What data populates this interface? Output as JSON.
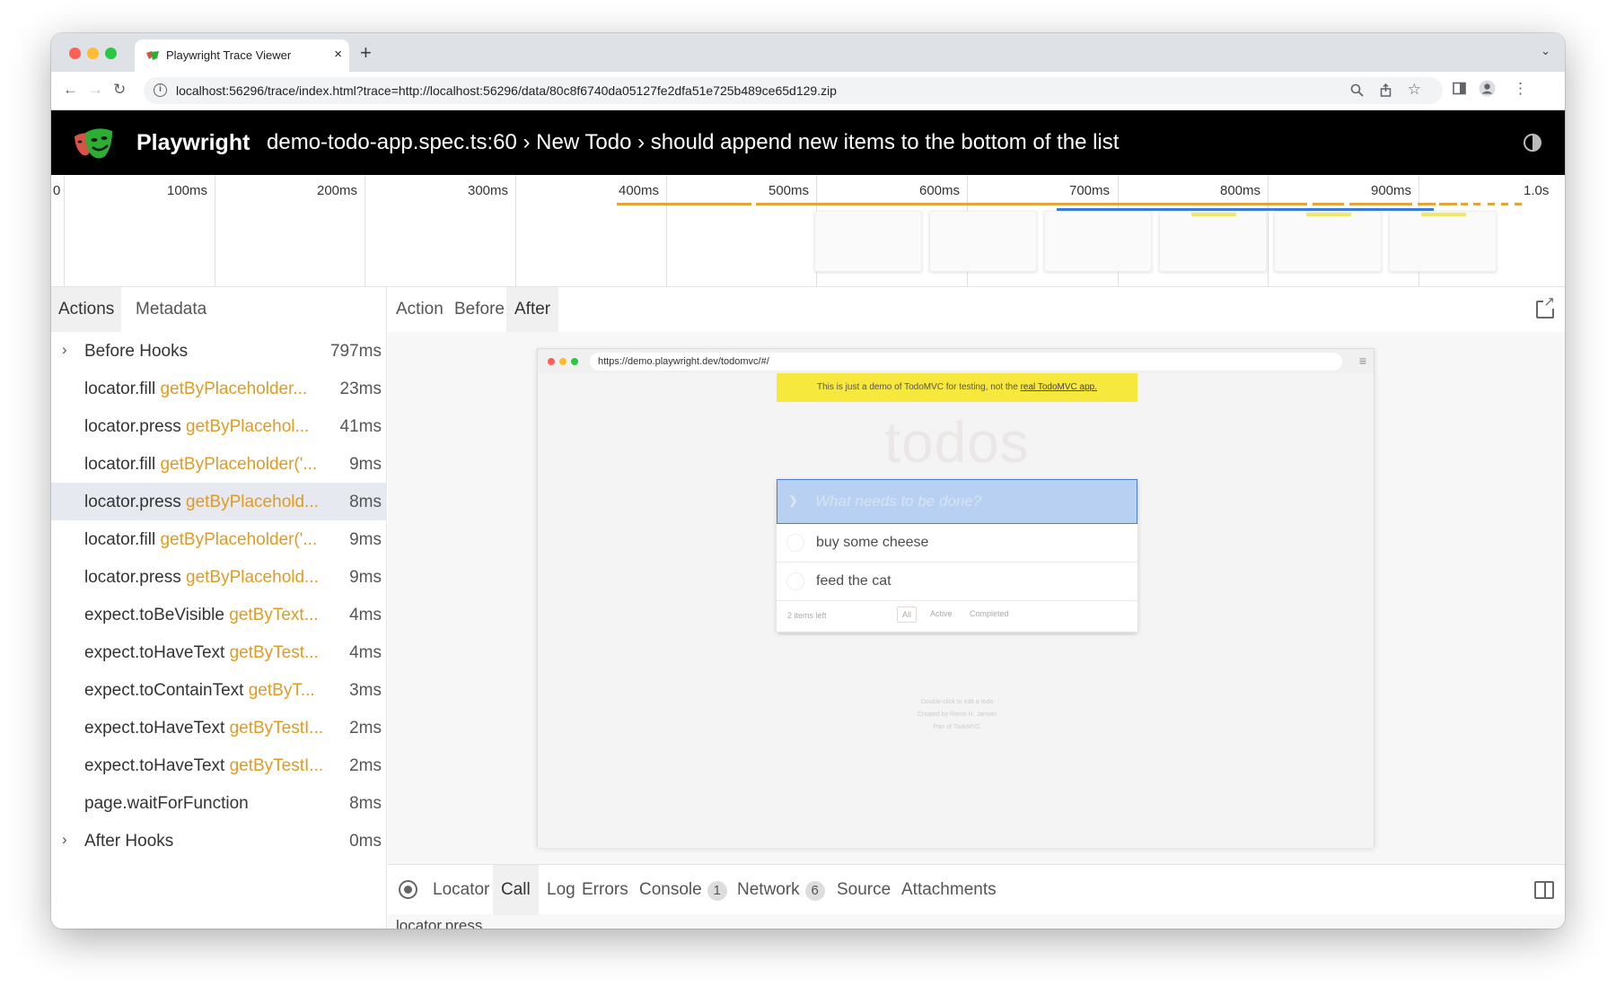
{
  "browser": {
    "tab_title": "Playwright Trace Viewer",
    "tab_close": "×",
    "new_tab": "+",
    "tab_menu": "⌄",
    "url": "localhost:56296/trace/index.html?trace=http://localhost:56296/data/80c8f6740da05127fe2dfa51e725b489ce65d129.zip"
  },
  "header": {
    "brand": "Playwright",
    "title": "demo-todo-app.spec.ts:60 › New Todo › should append new items to the bottom of the list"
  },
  "timeline": {
    "ticks": [
      "0",
      "100ms",
      "200ms",
      "300ms",
      "400ms",
      "500ms",
      "600ms",
      "700ms",
      "800ms",
      "900ms",
      "1.0s"
    ]
  },
  "left_tabs": [
    "Actions",
    "Metadata"
  ],
  "actions": [
    {
      "name": "Before Hooks",
      "selector": "",
      "duration": "797ms",
      "expandable": true
    },
    {
      "name": "locator.fill",
      "selector": "getByPlaceholder...",
      "duration": "23ms"
    },
    {
      "name": "locator.press",
      "selector": "getByPlacehol...",
      "duration": "41ms"
    },
    {
      "name": "locator.fill",
      "selector": "getByPlaceholder('...",
      "duration": "9ms"
    },
    {
      "name": "locator.press",
      "selector": "getByPlacehold...",
      "duration": "8ms",
      "selected": true
    },
    {
      "name": "locator.fill",
      "selector": "getByPlaceholder('...",
      "duration": "9ms"
    },
    {
      "name": "locator.press",
      "selector": "getByPlacehold...",
      "duration": "9ms"
    },
    {
      "name": "expect.toBeVisible",
      "selector": "getByText...",
      "duration": "4ms"
    },
    {
      "name": "expect.toHaveText",
      "selector": "getByTest...",
      "duration": "4ms"
    },
    {
      "name": "expect.toContainText",
      "selector": "getByT...",
      "duration": "3ms"
    },
    {
      "name": "expect.toHaveText",
      "selector": "getByTestI...",
      "duration": "2ms"
    },
    {
      "name": "expect.toHaveText",
      "selector": "getByTestI...",
      "duration": "2ms"
    },
    {
      "name": "page.waitForFunction",
      "selector": "",
      "duration": "8ms"
    },
    {
      "name": "After Hooks",
      "selector": "",
      "duration": "0ms",
      "expandable": true
    }
  ],
  "snapshot_tabs": [
    "Action",
    "Before",
    "After"
  ],
  "snapshot": {
    "url": "https://demo.playwright.dev/todomvc/#/",
    "banner_text": "This is just a demo of TodoMVC for testing, not the ",
    "banner_link": "real TodoMVC app.",
    "heading": "todos",
    "input_placeholder": "What needs to be done?",
    "items": [
      "buy some cheese",
      "feed the cat"
    ],
    "items_left": "2 items left",
    "filters": [
      "All",
      "Active",
      "Completed"
    ],
    "info": [
      "Double-click to edit a todo",
      "Created by Remo H. Jansen",
      "Part of TodoMVC"
    ]
  },
  "bottom_tabs": [
    {
      "label": "Locator",
      "badge": ""
    },
    {
      "label": "Call",
      "badge": "",
      "active": true
    },
    {
      "label": "Log",
      "badge": ""
    },
    {
      "label": "Errors",
      "badge": ""
    },
    {
      "label": "Console",
      "badge": "1"
    },
    {
      "label": "Network",
      "badge": "6"
    },
    {
      "label": "Source",
      "badge": ""
    },
    {
      "label": "Attachments",
      "badge": ""
    }
  ],
  "call_peek": "locator.press",
  "colors": {
    "accent_selector": "#df9b22",
    "timeline_orange": "#e0a53c",
    "timeline_blue": "#3a7bdb",
    "header_bg": "#000000",
    "selected_row": "#e6e9ef"
  }
}
